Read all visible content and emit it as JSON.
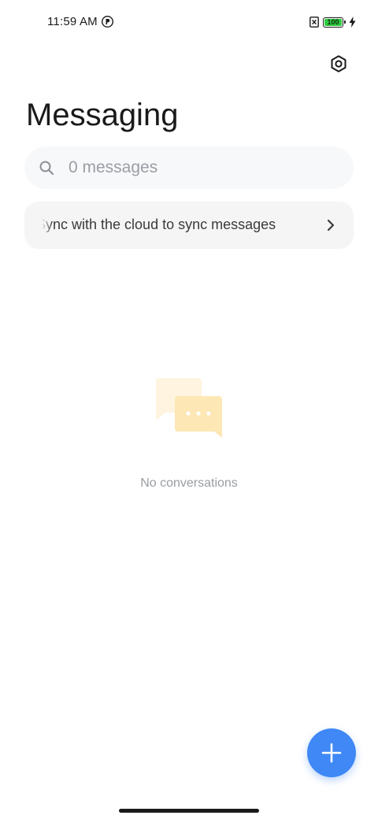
{
  "status_bar": {
    "time": "11:59 AM",
    "battery_level": "100",
    "app_icon": "pocket-p-icon",
    "sim_icon": "no-sim-icon",
    "charging_icon": "bolt-icon"
  },
  "header": {
    "title": "Messaging",
    "settings_icon": "settings-hexagon-icon"
  },
  "search": {
    "placeholder": "0 messages"
  },
  "sync_banner": {
    "text": "Sync with the cloud to sync messages"
  },
  "empty_state": {
    "text": "No conversations",
    "illustration": "chat-bubbles-icon"
  },
  "fab": {
    "icon": "plus-icon"
  },
  "colors": {
    "accent": "#3f88f5",
    "battery": "#2ecc40",
    "illustration": "#fde7b5"
  }
}
